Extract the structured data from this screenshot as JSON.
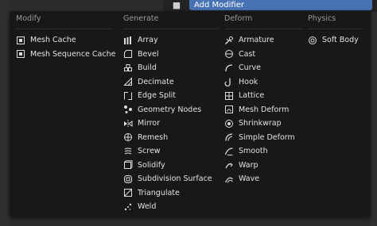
{
  "header": {
    "add_modifier_label": "Add Modifier"
  },
  "columns": [
    {
      "title": "Modify",
      "items": [
        {
          "label": "Mesh Cache",
          "icon": "mesh-cache-icon"
        },
        {
          "label": "Mesh Sequence Cache",
          "icon": "mesh-sequence-cache-icon"
        }
      ]
    },
    {
      "title": "Generate",
      "items": [
        {
          "label": "Array",
          "icon": "array-icon"
        },
        {
          "label": "Bevel",
          "icon": "bevel-icon"
        },
        {
          "label": "Build",
          "icon": "build-icon"
        },
        {
          "label": "Decimate",
          "icon": "decimate-icon"
        },
        {
          "label": "Edge Split",
          "icon": "edge-split-icon"
        },
        {
          "label": "Geometry Nodes",
          "icon": "geometry-nodes-icon"
        },
        {
          "label": "Mirror",
          "icon": "mirror-icon"
        },
        {
          "label": "Remesh",
          "icon": "remesh-icon"
        },
        {
          "label": "Screw",
          "icon": "screw-icon"
        },
        {
          "label": "Solidify",
          "icon": "solidify-icon"
        },
        {
          "label": "Subdivision Surface",
          "icon": "subdivision-surface-icon"
        },
        {
          "label": "Triangulate",
          "icon": "triangulate-icon"
        },
        {
          "label": "Weld",
          "icon": "weld-icon"
        }
      ]
    },
    {
      "title": "Deform",
      "items": [
        {
          "label": "Armature",
          "icon": "armature-icon"
        },
        {
          "label": "Cast",
          "icon": "cast-icon"
        },
        {
          "label": "Curve",
          "icon": "curve-icon"
        },
        {
          "label": "Hook",
          "icon": "hook-icon"
        },
        {
          "label": "Lattice",
          "icon": "lattice-icon"
        },
        {
          "label": "Mesh Deform",
          "icon": "mesh-deform-icon"
        },
        {
          "label": "Shrinkwrap",
          "icon": "shrinkwrap-icon"
        },
        {
          "label": "Simple Deform",
          "icon": "simple-deform-icon"
        },
        {
          "label": "Smooth",
          "icon": "smooth-icon"
        },
        {
          "label": "Warp",
          "icon": "warp-icon"
        },
        {
          "label": "Wave",
          "icon": "wave-icon"
        }
      ]
    },
    {
      "title": "Physics",
      "items": [
        {
          "label": "Soft Body",
          "icon": "soft-body-icon"
        }
      ]
    }
  ]
}
